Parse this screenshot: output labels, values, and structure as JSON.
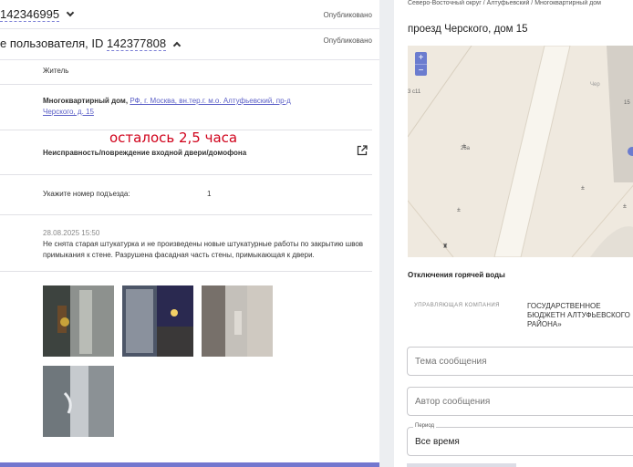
{
  "left": {
    "ticket_id": "142346995",
    "ticket_status": "Опубликовано",
    "subtitle_prefix": "е пользователя, ID",
    "subtitle_id": "142377808",
    "subtitle_status": "Опубликовано",
    "role": "Житель",
    "building_label": "Многоквартирный дом,",
    "building_link": "РФ, г. Москва, вн.тер.г. м.о. Алтуфьевский, пр-д Черского, д. 15",
    "time_left": "осталось 2,5 часа",
    "issue": "Неисправность/повреждение входной двери/домофона",
    "entrance_label": "Укажите номер подъезда:",
    "entrance_value": "1",
    "comment_date": "28.08.2025 15:50",
    "comment_text": "Не снята старая штукатурка и не произведены новые штукатурные работы по закрытию швов примыкания к стене. Разрушена фасадная часть стены, примыкающая к двери."
  },
  "right": {
    "breadcrumbs": "Северо-Восточный округ / Алтуфьевский / Многоквартирный дом",
    "address_title": "проезд Черского, дом 15",
    "map_labels": {
      "num": "15",
      "street": "26а",
      "left": "3 с11",
      "chip": "Чер"
    },
    "zoom_in": "+",
    "zoom_out": "−",
    "hot_water_title": "Отключения горячей воды",
    "uk_label": "УПРАВЛЯЮЩАЯ КОМПАНИЯ",
    "uk_value": "ГОСУДАРСТВЕННОЕ БЮДЖЕТН АЛТУФЬЕВСКОГО РАЙОНА»",
    "topic_placeholder": "Тема сообщения",
    "author_placeholder": "Автор сообщения",
    "period_legend": "Период",
    "period_value": "Все время"
  },
  "colors": {
    "accent": "#5b5fc7",
    "alert": "#d0021b",
    "map_bg": "#efe9df"
  },
  "icons": [
    "chevron-down-icon",
    "chevron-up-icon",
    "external-link-icon",
    "zoom-in-icon",
    "zoom-out-icon"
  ]
}
